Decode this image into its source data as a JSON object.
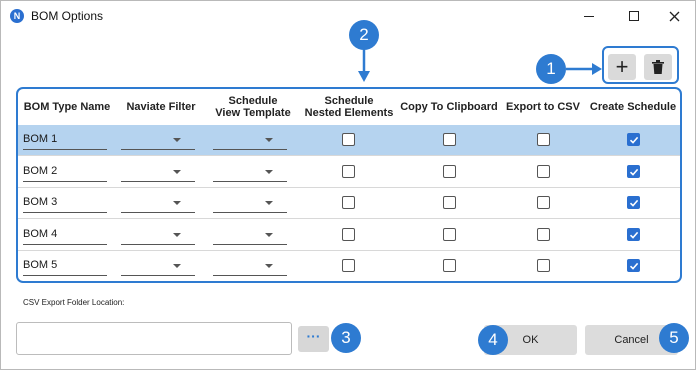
{
  "window": {
    "title": "BOM Options",
    "app_icon_letter": "N"
  },
  "toolbar": {
    "add_label": "+",
    "delete_icon": "trash-icon"
  },
  "callouts": [
    "1",
    "2",
    "3",
    "4",
    "5"
  ],
  "table": {
    "headers": [
      "BOM Type Name",
      "Naviate Filter",
      "Schedule\nView Template",
      "Schedule\nNested Elements",
      "Copy To Clipboard",
      "Export to CSV",
      "Create Schedule"
    ],
    "rows": [
      {
        "name": "BOM 1",
        "filter": "",
        "template": "",
        "nested": false,
        "clipboard": false,
        "csv": false,
        "schedule": true,
        "selected": true
      },
      {
        "name": "BOM 2",
        "filter": "",
        "template": "",
        "nested": false,
        "clipboard": false,
        "csv": false,
        "schedule": true,
        "selected": false
      },
      {
        "name": "BOM 3",
        "filter": "",
        "template": "",
        "nested": false,
        "clipboard": false,
        "csv": false,
        "schedule": true,
        "selected": false
      },
      {
        "name": "BOM 4",
        "filter": "",
        "template": "",
        "nested": false,
        "clipboard": false,
        "csv": false,
        "schedule": true,
        "selected": false
      },
      {
        "name": "BOM 5",
        "filter": "",
        "template": "",
        "nested": false,
        "clipboard": false,
        "csv": false,
        "schedule": true,
        "selected": false
      }
    ]
  },
  "csv": {
    "label": "CSV Export Folder Location:",
    "value": "",
    "browse_label": "···"
  },
  "buttons": {
    "ok": "OK",
    "cancel": "Cancel"
  },
  "colors": {
    "accent": "#2e7bd1",
    "selected_row": "#b5d3ef",
    "checkbox_checked": "#2a6fd0"
  }
}
